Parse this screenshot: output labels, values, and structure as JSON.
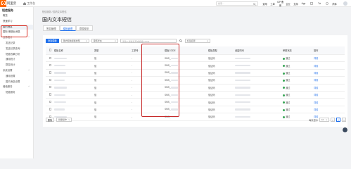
{
  "header": {
    "logo_icon": "[-]",
    "logo_brand": "阿里云",
    "workbench": "工作台",
    "search_placeholder": "搜索...",
    "nav": [
      "费用",
      "工单",
      "ICP 备案",
      "企业",
      "支持",
      "App",
      "",
      "",
      "",
      "简体"
    ],
    "accent": "#ff6a00"
  },
  "sidebar": {
    "title": "短信服务",
    "items": [
      {
        "label": "概览",
        "kind": "item"
      },
      {
        "label": "快速学习",
        "kind": "item"
      },
      {
        "label": "国内消息",
        "kind": "item",
        "active": true
      },
      {
        "label": "国际/港澳台消息",
        "kind": "item"
      },
      {
        "label": "业务统计",
        "kind": "group"
      },
      {
        "label": "发送记录",
        "kind": "sub"
      },
      {
        "label": "发送记录查询",
        "kind": "sub"
      },
      {
        "label": "短链效果分析",
        "kind": "sub"
      },
      {
        "label": "通用统计",
        "kind": "sub"
      },
      {
        "label": "群发统计",
        "kind": "sub"
      },
      {
        "label": "系统设置",
        "kind": "group"
      },
      {
        "label": "通用设置",
        "kind": "sub"
      },
      {
        "label": "国内消息设置",
        "kind": "sub"
      },
      {
        "label": "增值服务",
        "kind": "group"
      },
      {
        "label": "短链服务",
        "kind": "sub"
      }
    ]
  },
  "main": {
    "breadcrumb": "短信服务 / 国内文本短信",
    "title": "国内文本短信",
    "tabs": [
      {
        "label": "签名管理"
      },
      {
        "label": "模板管理",
        "active": true
      },
      {
        "label": "群发助手"
      }
    ],
    "toolbar": {
      "add_button": "添加模板",
      "type_filter": "国内短信模板类型",
      "status_filter": "审核状态",
      "search_placeholder": "请输入模板名称或模板CODE",
      "group_filter": "标签名称"
    },
    "table": {
      "headers": [
        "模板名称",
        "类型",
        "工单号",
        "模板CODE",
        "模板内容",
        "模板类型",
        "创建时间",
        "审核状态",
        "操作"
      ],
      "rows": [
        {
          "type": "验",
          "ticket": "-",
          "code": "SMS_",
          "kind": "验证码",
          "status": "通过",
          "action": "详情"
        },
        {
          "type": "验",
          "ticket": "-",
          "code": "SMS_",
          "kind": "验证码",
          "status": "通过",
          "action": "详情"
        },
        {
          "type": "验",
          "ticket": "-",
          "code": "SMS_",
          "kind": "验证码",
          "status": "通过",
          "action": "详情"
        },
        {
          "type": "验",
          "ticket": "-",
          "code": "SMS_",
          "kind": "验证码",
          "status": "通过",
          "action": "详情"
        },
        {
          "type": "验",
          "ticket": "-",
          "code": "SMS_",
          "kind": "验证码",
          "status": "通过",
          "action": "详情"
        },
        {
          "type": "验",
          "ticket": "-",
          "code": "SMS_",
          "kind": "验证码",
          "status": "通过",
          "action": "详情"
        },
        {
          "type": "验",
          "ticket": "-",
          "code": "SMS_",
          "kind": "验证码",
          "status": "通过",
          "action": "详情"
        },
        {
          "type": "验",
          "ticket": "-",
          "code": "SMS_",
          "kind": "验证码",
          "status": "通过",
          "action": "详情"
        },
        {
          "type": "验",
          "ticket": "-",
          "code": "SMS_",
          "kind": "验证码",
          "status": "通过",
          "action": "详情"
        }
      ]
    },
    "footer": {
      "delete_button": "删除",
      "batch_select": "批量操作",
      "page_size_label": "每页显示",
      "page_size": "10",
      "current_page": "1"
    }
  },
  "colors": {
    "primary": "#1f6feb",
    "success": "#3aa757",
    "highlight": "#d93025"
  }
}
